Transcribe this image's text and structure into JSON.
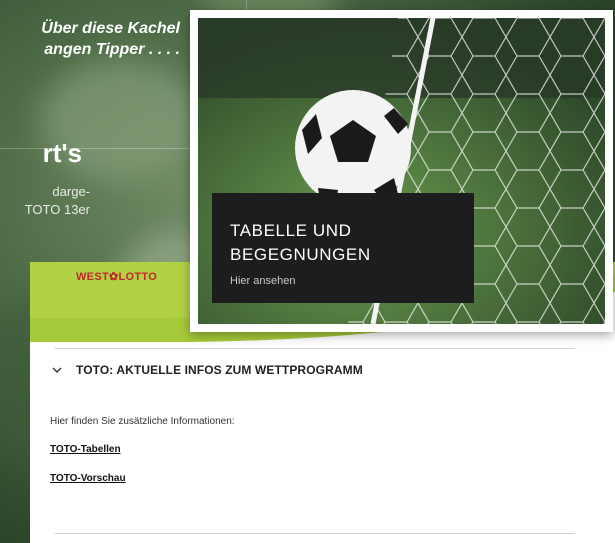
{
  "background": {
    "caption_line1": "Über diese Kachel",
    "caption_line2": "angen Tipper  . . . .",
    "headline": "rt's",
    "sub_line1": "darge-",
    "sub_line2": "TOTO 13er"
  },
  "tile": {
    "title_line1": "TABELLE UND",
    "title_line2": "BEGEGNUNGEN",
    "link": "Hier ansehen"
  },
  "panel": {
    "logo_west": "WEST",
    "logo_lotto": "LOTTO",
    "accordion_title": "TOTO: AKTUELLE INFOS ZUM WETTPROGRAMM",
    "info_text": "Hier finden Sie zusätzliche Informationen:",
    "links": [
      "TOTO-Tabellen",
      "TOTO-Vorschau"
    ]
  },
  "colors": {
    "accent_green": "#a6c93a",
    "brand_red": "#c0282e",
    "caption_bg": "#1d1d1f"
  }
}
